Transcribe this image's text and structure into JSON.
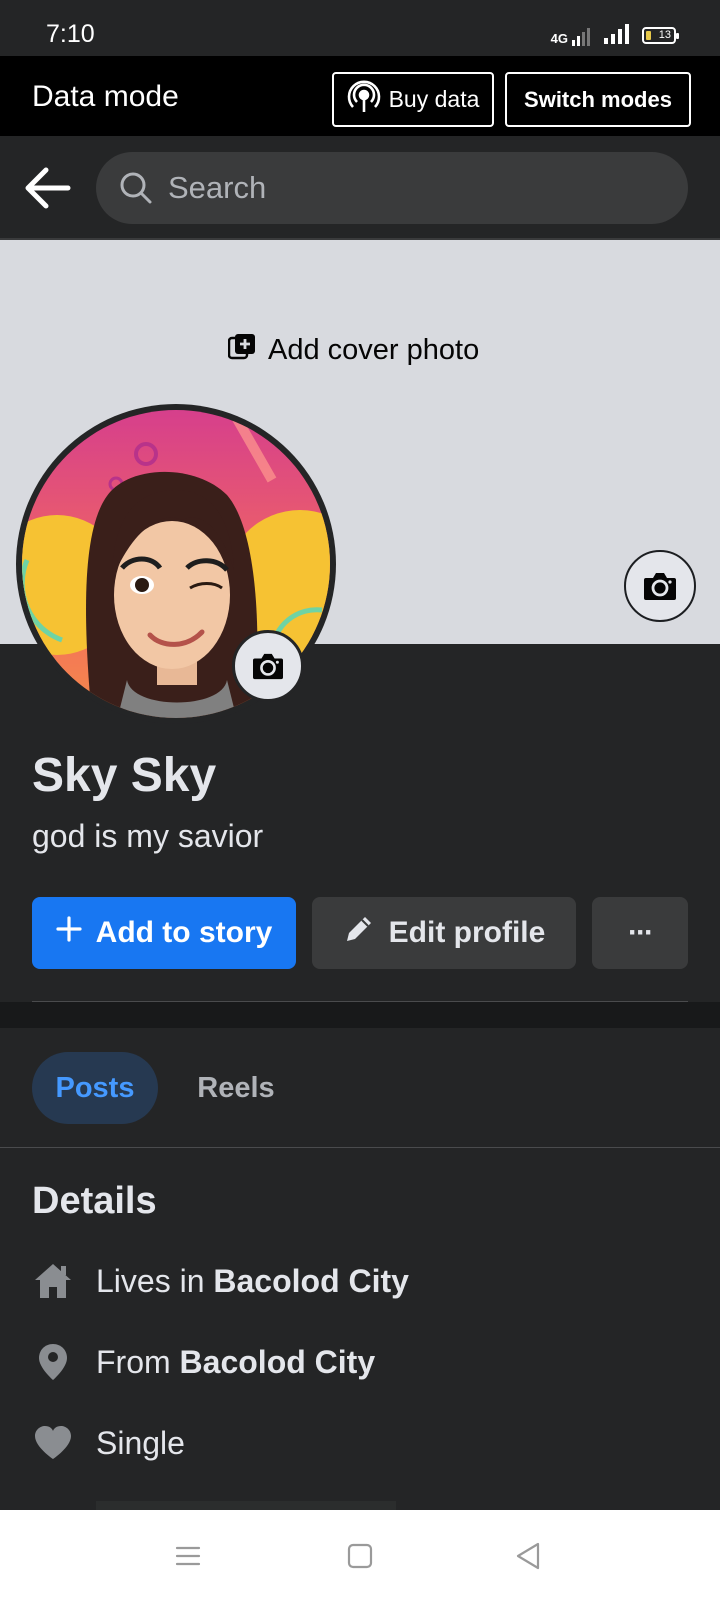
{
  "status_bar": {
    "time": "7:10",
    "network": "4G",
    "battery": "13"
  },
  "data_mode": {
    "title": "Data mode",
    "buy_data_label": "Buy data",
    "switch_modes_label": "Switch modes"
  },
  "search": {
    "placeholder": "Search"
  },
  "cover": {
    "add_cover_label": "Add cover photo"
  },
  "profile": {
    "name": "Sky Sky",
    "bio": "god is my savior"
  },
  "actions": {
    "add_story_label": "Add to story",
    "edit_profile_label": "Edit profile",
    "more_label": "···"
  },
  "tabs": [
    {
      "label": "Posts",
      "active": true
    },
    {
      "label": "Reels",
      "active": false
    }
  ],
  "details": {
    "title": "Details",
    "lives_prefix": "Lives in ",
    "lives_value": "Bacolod City",
    "from_prefix": "From ",
    "from_value": "Bacolod City",
    "relationship": "Single"
  },
  "colors": {
    "accent": "#1877f2",
    "background": "#242526",
    "tab_active_bg": "#263951",
    "tab_active_text": "#4599ff"
  }
}
